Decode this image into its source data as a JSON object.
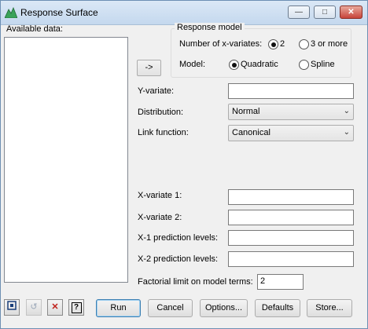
{
  "window": {
    "title": "Response Surface"
  },
  "available_data": {
    "label": "Available data:"
  },
  "transfer_button": {
    "label": "->"
  },
  "response_model": {
    "title": "Response model",
    "x_variates_label": "Number of x-variates:",
    "x_variates_options": [
      "2",
      "3 or more"
    ],
    "x_variates_selected": "2",
    "model_label": "Model:",
    "model_options": [
      "Quadratic",
      "Spline"
    ],
    "model_selected": "Quadratic"
  },
  "fields": {
    "y_variate": {
      "label": "Y-variate:",
      "value": ""
    },
    "distribution": {
      "label": "Distribution:",
      "value": "Normal"
    },
    "link_function": {
      "label": "Link function:",
      "value": "Canonical"
    },
    "x_variate_1": {
      "label": "X-variate 1:",
      "value": ""
    },
    "x_variate_2": {
      "label": "X-variate 2:",
      "value": ""
    },
    "x1_levels": {
      "label": "X-1 prediction levels:",
      "value": ""
    },
    "x2_levels": {
      "label": "X-2 prediction levels:",
      "value": ""
    },
    "factorial_limit": {
      "label": "Factorial limit on model terms:",
      "value": "2"
    }
  },
  "buttons": {
    "run": "Run",
    "cancel": "Cancel",
    "options": "Options...",
    "defaults": "Defaults",
    "store": "Store..."
  },
  "toolbar_icons": [
    "pin-icon",
    "undo-icon",
    "clear-icon",
    "help-icon"
  ],
  "colors": {
    "accent": "#3c7fb1",
    "close": "#c7443a"
  }
}
